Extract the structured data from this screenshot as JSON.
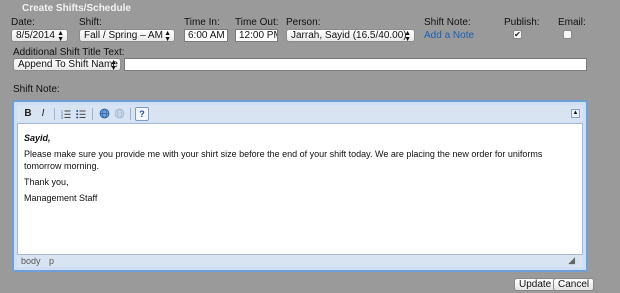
{
  "panel": {
    "title": "Create Shifts/Schedule"
  },
  "labels": {
    "date": "Date:",
    "shift": "Shift:",
    "time_in": "Time In:",
    "time_out": "Time Out:",
    "person": "Person:",
    "shift_note": "Shift Note:",
    "publish": "Publish:",
    "email": "Email:",
    "additional_title": "Additional Shift Title Text:",
    "shift_note_editor": "Shift Note:"
  },
  "fields": {
    "date": "8/5/2014",
    "shift": "Fall / Spring – AM",
    "time_in": "6:00 AM",
    "time_out": "12:00 PM",
    "person": "Jarrah, Sayid (16.5/40.00)",
    "add_note_link": "Add a Note",
    "publish_checked": "✔",
    "email_checked": "",
    "append_mode": "Append To Shift Name",
    "additional_title_value": ""
  },
  "editor": {
    "toolbar": {
      "bold": "B",
      "italic": "I",
      "ordered_list": "☰",
      "unordered_list": "≡",
      "help": "?"
    },
    "content": {
      "greeting": "Sayid,",
      "body": "Please make sure you provide me with your shirt size before the end of your shift today.  We are placing the new order for uniforms tomorrow morning.",
      "closing": "Thank you,",
      "signature": "Management Staff"
    },
    "status": {
      "path1": "body",
      "path2": "p"
    }
  },
  "buttons": {
    "update": "Update",
    "cancel": "Cancel"
  }
}
